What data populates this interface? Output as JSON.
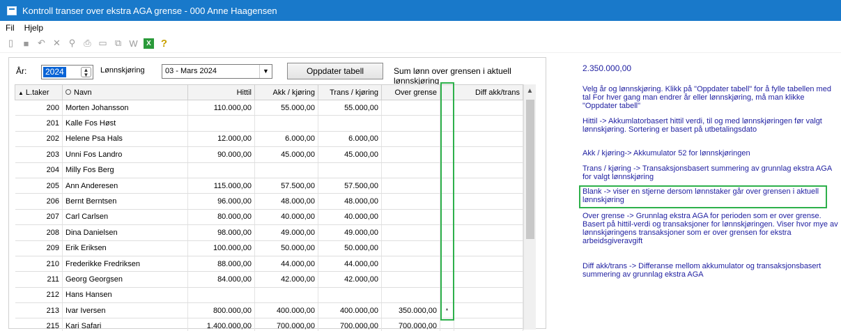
{
  "window": {
    "title": "Kontroll transer over ekstra AGA grense - 000 Anne Haagensen"
  },
  "menu": {
    "items": [
      "Fil",
      "Hjelp"
    ]
  },
  "toolbar": {
    "icons": [
      "new-file-icon",
      "save-icon",
      "undo-icon",
      "delete-icon",
      "find-icon",
      "print-icon",
      "preview-icon",
      "copy-icon",
      "word-export-icon",
      "excel-export-icon",
      "help-icon"
    ]
  },
  "controls": {
    "year_label": "År:",
    "year_value": "2024",
    "payroll_label": "Lønnskjøring",
    "payroll_value": "03 - Mars 2024",
    "update_button": "Oppdater tabell",
    "sum_label": "Sum lønn over grensen i aktuell lønnskjøring",
    "sum_value": "2.350.000,00"
  },
  "table": {
    "columns": [
      "L.taker",
      "Navn",
      "Hittil",
      "Akk / kjøring",
      "Trans / kjøring",
      "Over grense",
      "",
      "Diff akk/trans"
    ],
    "rows": [
      [
        "200",
        "Morten Johansson",
        "110.000,00",
        "55.000,00",
        "55.000,00",
        "",
        "",
        ""
      ],
      [
        "201",
        "Kalle Fos Høst",
        "",
        "",
        "",
        "",
        "",
        ""
      ],
      [
        "202",
        "Helene Psa Hals",
        "12.000,00",
        "6.000,00",
        "6.000,00",
        "",
        "",
        ""
      ],
      [
        "203",
        "Unni Fos Landro",
        "90.000,00",
        "45.000,00",
        "45.000,00",
        "",
        "",
        ""
      ],
      [
        "204",
        "Milly Fos Berg",
        "",
        "",
        "",
        "",
        "",
        ""
      ],
      [
        "205",
        "Ann Anderesen",
        "115.000,00",
        "57.500,00",
        "57.500,00",
        "",
        "",
        ""
      ],
      [
        "206",
        "Bernt Berntsen",
        "96.000,00",
        "48.000,00",
        "48.000,00",
        "",
        "",
        ""
      ],
      [
        "207",
        "Carl Carlsen",
        "80.000,00",
        "40.000,00",
        "40.000,00",
        "",
        "",
        ""
      ],
      [
        "208",
        "Dina Danielsen",
        "98.000,00",
        "49.000,00",
        "49.000,00",
        "",
        "",
        ""
      ],
      [
        "209",
        "Erik Eriksen",
        "100.000,00",
        "50.000,00",
        "50.000,00",
        "",
        "",
        ""
      ],
      [
        "210",
        "Frederikke Fredriksen",
        "88.000,00",
        "44.000,00",
        "44.000,00",
        "",
        "",
        ""
      ],
      [
        "211",
        "Georg Georgsen",
        "84.000,00",
        "42.000,00",
        "42.000,00",
        "",
        "",
        ""
      ],
      [
        "212",
        "Hans Hansen",
        "",
        "",
        "",
        "",
        "",
        ""
      ],
      [
        "213",
        "Ivar Iversen",
        "800.000,00",
        "400.000,00",
        "400.000,00",
        "350.000,00",
        "*",
        ""
      ],
      [
        "215",
        "Kari Safari",
        "1.400.000,00",
        "700.000,00",
        "700.000,00",
        "700.000,00",
        "",
        ""
      ]
    ]
  },
  "help": {
    "p1": "Velg år og lønnskjøring. Klikk på \"Oppdater tabell\" for å fylle tabellen med tal For hver gang man endrer år eller lønnskjøring, må man klikke \"Oppdater tabell\"",
    "p2": "Hittil -> Akkumlatorbasert hittil verdi, til og med lønnskjøringen før valgt lønnskjøring. Sortering er basert på utbetalingsdato",
    "p3": "Akk / kjøring-> Akkumulator 52 for lønnskjøringen",
    "p4": "Trans / kjøring -> Transaksjonsbasert summering av grunnlag ekstra AGA for valgt lønnskjøring",
    "p5": "Blank -> viser en stjerne dersom lønnstaker går over grensen i aktuell lønnskjøring",
    "p6": "Over grense -> Grunnlag ekstra AGA for perioden som er over grense. Basert på hittil-verdi og transaksjoner for lønnskjøringen. Viser hvor mye av lønnskjøringens transaksjoner som er over grensen for ekstra arbeidsgiveravgift",
    "p7": "Diff akk/trans -> Differanse mellom akkumulator og transaksjonsbasert summering av grunnlag ekstra AGA"
  },
  "colors": {
    "titlebar": "#1979ca",
    "help_text": "#1e1ea0",
    "highlight": "#2db04a",
    "selection": "#0a64d6"
  }
}
